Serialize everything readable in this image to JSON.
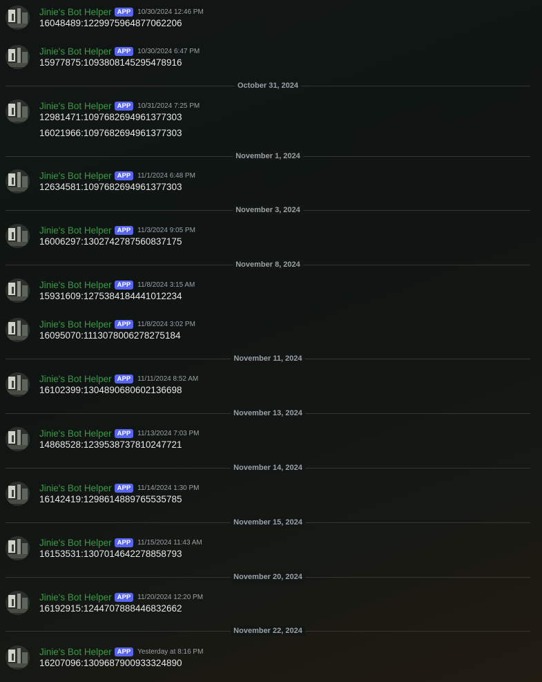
{
  "author": "Jinie's Bot Helper",
  "badge": "APP",
  "messages": [
    {
      "ts": "10/30/2024 12:46 PM",
      "lines": [
        "16048489:1229975964877062206"
      ]
    },
    {
      "ts": "10/30/2024 6:47 PM",
      "lines": [
        "15977875:1093808145295478916"
      ]
    },
    {
      "ts": "10/31/2024 7:25 PM",
      "lines": [
        "12981471:1097682694961377303",
        "16021966:1097682694961377303"
      ]
    },
    {
      "ts": "11/1/2024 6:48 PM",
      "lines": [
        "12634581:1097682694961377303"
      ]
    },
    {
      "ts": "11/3/2024 9:05 PM",
      "lines": [
        "16006297:1302742787560837175"
      ]
    },
    {
      "ts": "11/8/2024 3:15 AM",
      "lines": [
        "15931609:1275384184441012234"
      ]
    },
    {
      "ts": "11/8/2024 3:02 PM",
      "lines": [
        "16095070:1113078006278275184"
      ]
    },
    {
      "ts": "11/11/2024 8:52 AM",
      "lines": [
        "16102399:1304890680602136698"
      ]
    },
    {
      "ts": "11/13/2024 7:03 PM",
      "lines": [
        "14868528:1239538737810247721"
      ]
    },
    {
      "ts": "11/14/2024 1:30 PM",
      "lines": [
        "16142419:1298614889765535785"
      ]
    },
    {
      "ts": "11/15/2024 11:43 AM",
      "lines": [
        "16153531:1307014642278858793"
      ]
    },
    {
      "ts": "11/20/2024 12:20 PM",
      "lines": [
        "16192915:1244707888446832662"
      ]
    },
    {
      "ts": "Yesterday at 8:16 PM",
      "lines": [
        "16207096:1309687900933324890"
      ]
    }
  ],
  "dividers": [
    "October 31, 2024",
    "November 1, 2024",
    "November 3, 2024",
    "November 8, 2024",
    "November 11, 2024",
    "November 13, 2024",
    "November 14, 2024",
    "November 15, 2024",
    "November 20, 2024",
    "November 22, 2024"
  ]
}
